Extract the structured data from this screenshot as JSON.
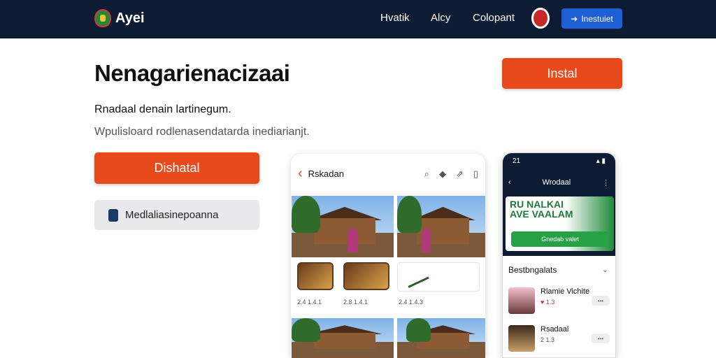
{
  "header": {
    "brand": "Ayei",
    "nav": [
      "Hvatik",
      "Alcy",
      "Colopant"
    ],
    "signin_icon": "arrow-icon",
    "signin_label": "Inestuiet"
  },
  "hero": {
    "title": "Nenagarienacizaai",
    "install_label": "Instal",
    "tagline": "Rnadaal denain lartinegum.",
    "subtitle": "Wpulisloard rodlenasendatarda inediarianjt.",
    "download_label": "Dishatal",
    "store_label": "Medlaliasinepoanna"
  },
  "tablet": {
    "title": "Rskadan",
    "tiles": [
      "2.4 1.4.1",
      "2.8 1.4.1",
      "2.4 1.4.3"
    ]
  },
  "phone": {
    "time": "21",
    "title": "Wrodaal",
    "banner_line1": "RU NALKAI",
    "banner_line2": "AVE VAALAM",
    "banner_btn": "Gnedab valet",
    "section": "Bestbngalats",
    "people": [
      {
        "name": "Rlamie Vichite",
        "meta": "♥ 1.3"
      },
      {
        "name": "Rsadaal",
        "meta": "2 1.3"
      }
    ]
  },
  "colors": {
    "accent": "#e84a1c",
    "nav_bg": "#0d1b33",
    "signin": "#1f5fd6"
  }
}
